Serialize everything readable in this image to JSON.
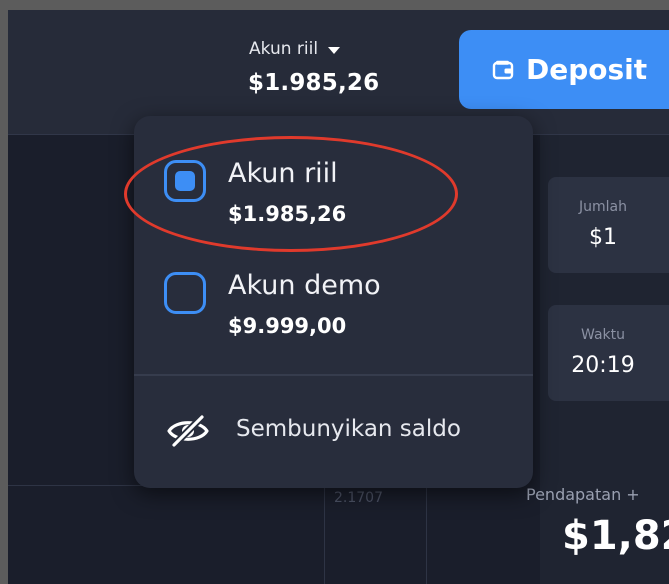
{
  "header": {
    "account_type_label": "Akun riil",
    "balance": "$1.985,26",
    "deposit_label": "Deposit",
    "caret_icon": "caret-down-icon",
    "wallet_icon": "wallet-icon"
  },
  "dropdown": {
    "options": [
      {
        "name": "Akun riil",
        "balance": "$1.985,26",
        "selected": true
      },
      {
        "name": "Akun demo",
        "balance": "$9.999,00",
        "selected": false
      }
    ],
    "hide_balance_label": "Sembunyikan saldo",
    "hide_balance_icon": "eye-slash-icon"
  },
  "trade_panel": {
    "amount_label": "Jumlah",
    "amount_value": "$1",
    "time_label": "Waktu",
    "time_value": "20:19",
    "income_label": "Pendapatan +",
    "income_value": "$1,82"
  },
  "chart": {
    "price_label": "2.1707"
  },
  "colors": {
    "accent": "#3d8ef5",
    "background": "#1a1e2b",
    "dropdown_bg": "#282d3c",
    "highlight": "#e03a2c"
  }
}
